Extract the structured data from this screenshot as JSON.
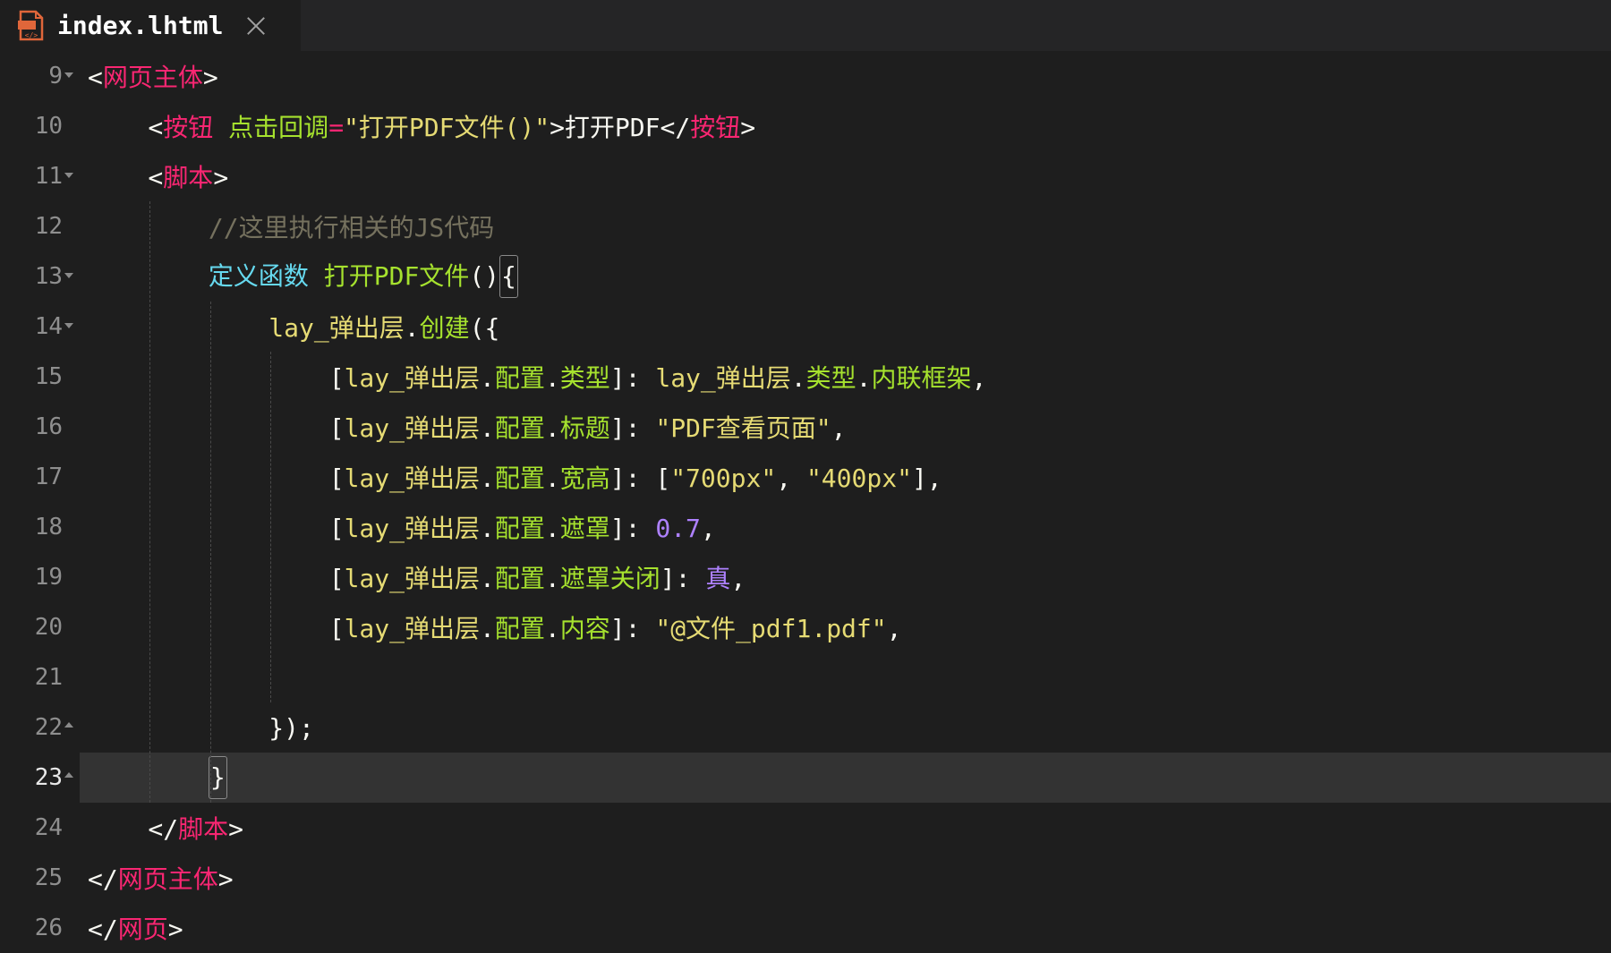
{
  "tab": {
    "filename": "index.lhtml",
    "icon": "html-file-icon",
    "close_icon": "close-icon"
  },
  "colors": {
    "background": "#1e1e1e",
    "tag": "#f92672",
    "attribute": "#a6e22e",
    "string": "#e6db74",
    "comment": "#75715e",
    "keyword": "#66d9ef",
    "number": "#ae81ff"
  },
  "editor": {
    "current_line": "23",
    "lines": [
      {
        "num": "9",
        "fold": "open",
        "tokens": [
          [
            "<",
            "pn"
          ],
          [
            "网页主体",
            "tag"
          ],
          [
            ">",
            "pn"
          ]
        ]
      },
      {
        "num": "10",
        "tokens": [
          [
            "    <",
            "pn"
          ],
          [
            "按钮",
            "tag"
          ],
          [
            " ",
            "pn"
          ],
          [
            "点击回调",
            "attr"
          ],
          [
            "=",
            "op"
          ],
          [
            "\"打开PDF文件()\"",
            "str"
          ],
          [
            ">打开PDF</",
            "pn"
          ],
          [
            "按钮",
            "tag"
          ],
          [
            ">",
            "pn"
          ]
        ]
      },
      {
        "num": "11",
        "fold": "open",
        "tokens": [
          [
            "    <",
            "pn"
          ],
          [
            "脚本",
            "tag"
          ],
          [
            ">",
            "pn"
          ]
        ]
      },
      {
        "num": "12",
        "tokens": [
          [
            "        //这里执行相关的JS代码",
            "comment"
          ]
        ]
      },
      {
        "num": "13",
        "fold": "open",
        "tokens": [
          [
            "        ",
            "pn"
          ],
          [
            "定义函数",
            "kw"
          ],
          [
            " ",
            "pn"
          ],
          [
            "打开PDF文件",
            "fn"
          ],
          [
            "()",
            "pn"
          ],
          [
            "{",
            "box"
          ]
        ]
      },
      {
        "num": "14",
        "fold": "open",
        "tokens": [
          [
            "            ",
            "pn"
          ],
          [
            "lay_弹出层",
            "id"
          ],
          [
            ".",
            "pn"
          ],
          [
            "创建",
            "fn"
          ],
          [
            "({",
            "pn"
          ]
        ]
      },
      {
        "num": "15",
        "tokens": [
          [
            "                [",
            "pn"
          ],
          [
            "lay_弹出层",
            "id"
          ],
          [
            ".",
            "pn"
          ],
          [
            "配置",
            "fn"
          ],
          [
            ".",
            "pn"
          ],
          [
            "类型",
            "fn"
          ],
          [
            "]: ",
            "pn"
          ],
          [
            "lay_弹出层",
            "id"
          ],
          [
            ".",
            "pn"
          ],
          [
            "类型",
            "fn"
          ],
          [
            ".",
            "pn"
          ],
          [
            "内联框架",
            "fn"
          ],
          [
            ",",
            "pn"
          ]
        ]
      },
      {
        "num": "16",
        "tokens": [
          [
            "                [",
            "pn"
          ],
          [
            "lay_弹出层",
            "id"
          ],
          [
            ".",
            "pn"
          ],
          [
            "配置",
            "fn"
          ],
          [
            ".",
            "pn"
          ],
          [
            "标题",
            "fn"
          ],
          [
            "]: ",
            "pn"
          ],
          [
            "\"PDF查看页面\"",
            "str"
          ],
          [
            ",",
            "pn"
          ]
        ]
      },
      {
        "num": "17",
        "tokens": [
          [
            "                [",
            "pn"
          ],
          [
            "lay_弹出层",
            "id"
          ],
          [
            ".",
            "pn"
          ],
          [
            "配置",
            "fn"
          ],
          [
            ".",
            "pn"
          ],
          [
            "宽高",
            "fn"
          ],
          [
            "]: [",
            "pn"
          ],
          [
            "\"700px\"",
            "str"
          ],
          [
            ", ",
            "pn"
          ],
          [
            "\"400px\"",
            "str"
          ],
          [
            "],",
            "pn"
          ]
        ]
      },
      {
        "num": "18",
        "tokens": [
          [
            "                [",
            "pn"
          ],
          [
            "lay_弹出层",
            "id"
          ],
          [
            ".",
            "pn"
          ],
          [
            "配置",
            "fn"
          ],
          [
            ".",
            "pn"
          ],
          [
            "遮罩",
            "fn"
          ],
          [
            "]: ",
            "pn"
          ],
          [
            "0.7",
            "num"
          ],
          [
            ",",
            "pn"
          ]
        ]
      },
      {
        "num": "19",
        "tokens": [
          [
            "                [",
            "pn"
          ],
          [
            "lay_弹出层",
            "id"
          ],
          [
            ".",
            "pn"
          ],
          [
            "配置",
            "fn"
          ],
          [
            ".",
            "pn"
          ],
          [
            "遮罩关闭",
            "fn"
          ],
          [
            "]: ",
            "pn"
          ],
          [
            "真",
            "num"
          ],
          [
            ",",
            "pn"
          ]
        ]
      },
      {
        "num": "20",
        "tokens": [
          [
            "                [",
            "pn"
          ],
          [
            "lay_弹出层",
            "id"
          ],
          [
            ".",
            "pn"
          ],
          [
            "配置",
            "fn"
          ],
          [
            ".",
            "pn"
          ],
          [
            "内容",
            "fn"
          ],
          [
            "]: ",
            "pn"
          ],
          [
            "\"@文件_pdf1.pdf\"",
            "str"
          ],
          [
            ",",
            "pn"
          ]
        ]
      },
      {
        "num": "21",
        "tokens": []
      },
      {
        "num": "22",
        "fold": "close",
        "tokens": [
          [
            "            });",
            "pn"
          ]
        ]
      },
      {
        "num": "23",
        "fold": "close",
        "tokens": [
          [
            "        ",
            "pn"
          ],
          [
            "}",
            "box"
          ]
        ]
      },
      {
        "num": "24",
        "tokens": [
          [
            "    </",
            "pn"
          ],
          [
            "脚本",
            "tag"
          ],
          [
            ">",
            "pn"
          ]
        ]
      },
      {
        "num": "25",
        "tokens": [
          [
            "</",
            "pn"
          ],
          [
            "网页主体",
            "tag"
          ],
          [
            ">",
            "pn"
          ]
        ]
      },
      {
        "num": "26",
        "tokens": [
          [
            "</",
            "pn"
          ],
          [
            "网页",
            "tag"
          ],
          [
            ">",
            "pn"
          ]
        ]
      }
    ]
  }
}
